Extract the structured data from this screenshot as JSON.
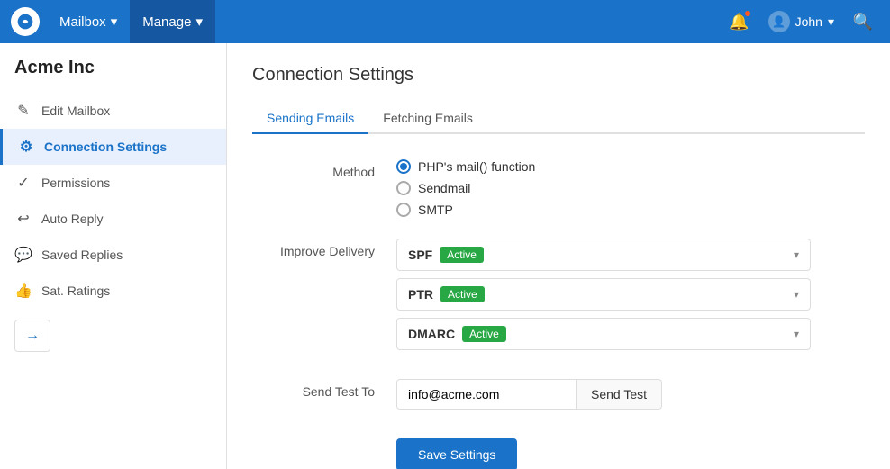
{
  "app": {
    "logo_alt": "Support App Logo"
  },
  "topnav": {
    "mailbox_label": "Mailbox",
    "manage_label": "Manage",
    "user_name": "John",
    "chevron": "▾",
    "bell_icon": "🔔",
    "search_icon": "🔍"
  },
  "sidebar": {
    "company_name": "Acme Inc",
    "items": [
      {
        "id": "edit-mailbox",
        "label": "Edit Mailbox",
        "icon": "✎",
        "active": false
      },
      {
        "id": "connection-settings",
        "label": "Connection Settings",
        "icon": "⚙",
        "active": true
      },
      {
        "id": "permissions",
        "label": "Permissions",
        "icon": "✓",
        "active": false
      },
      {
        "id": "auto-reply",
        "label": "Auto Reply",
        "icon": "↩",
        "active": false
      },
      {
        "id": "saved-replies",
        "label": "Saved Replies",
        "icon": "💬",
        "active": false
      },
      {
        "id": "sat-ratings",
        "label": "Sat. Ratings",
        "icon": "👍",
        "active": false
      }
    ],
    "arrow_icon": "→"
  },
  "main": {
    "page_title": "Connection Settings",
    "tabs": [
      {
        "id": "sending",
        "label": "Sending Emails",
        "active": true
      },
      {
        "id": "fetching",
        "label": "Fetching Emails",
        "active": false
      }
    ],
    "method_label": "Method",
    "method_options": [
      {
        "id": "php-mail",
        "label": "PHP's mail() function",
        "checked": true
      },
      {
        "id": "sendmail",
        "label": "Sendmail",
        "checked": false
      },
      {
        "id": "smtp",
        "label": "SMTP",
        "checked": false
      }
    ],
    "improve_delivery_label": "Improve Delivery",
    "delivery_items": [
      {
        "name": "SPF",
        "status": "Active"
      },
      {
        "name": "PTR",
        "status": "Active"
      },
      {
        "name": "DMARC",
        "status": "Active"
      }
    ],
    "send_test_label": "Send Test To",
    "send_test_placeholder": "info@acme.com",
    "send_test_button": "Send Test",
    "save_button": "Save Settings"
  }
}
